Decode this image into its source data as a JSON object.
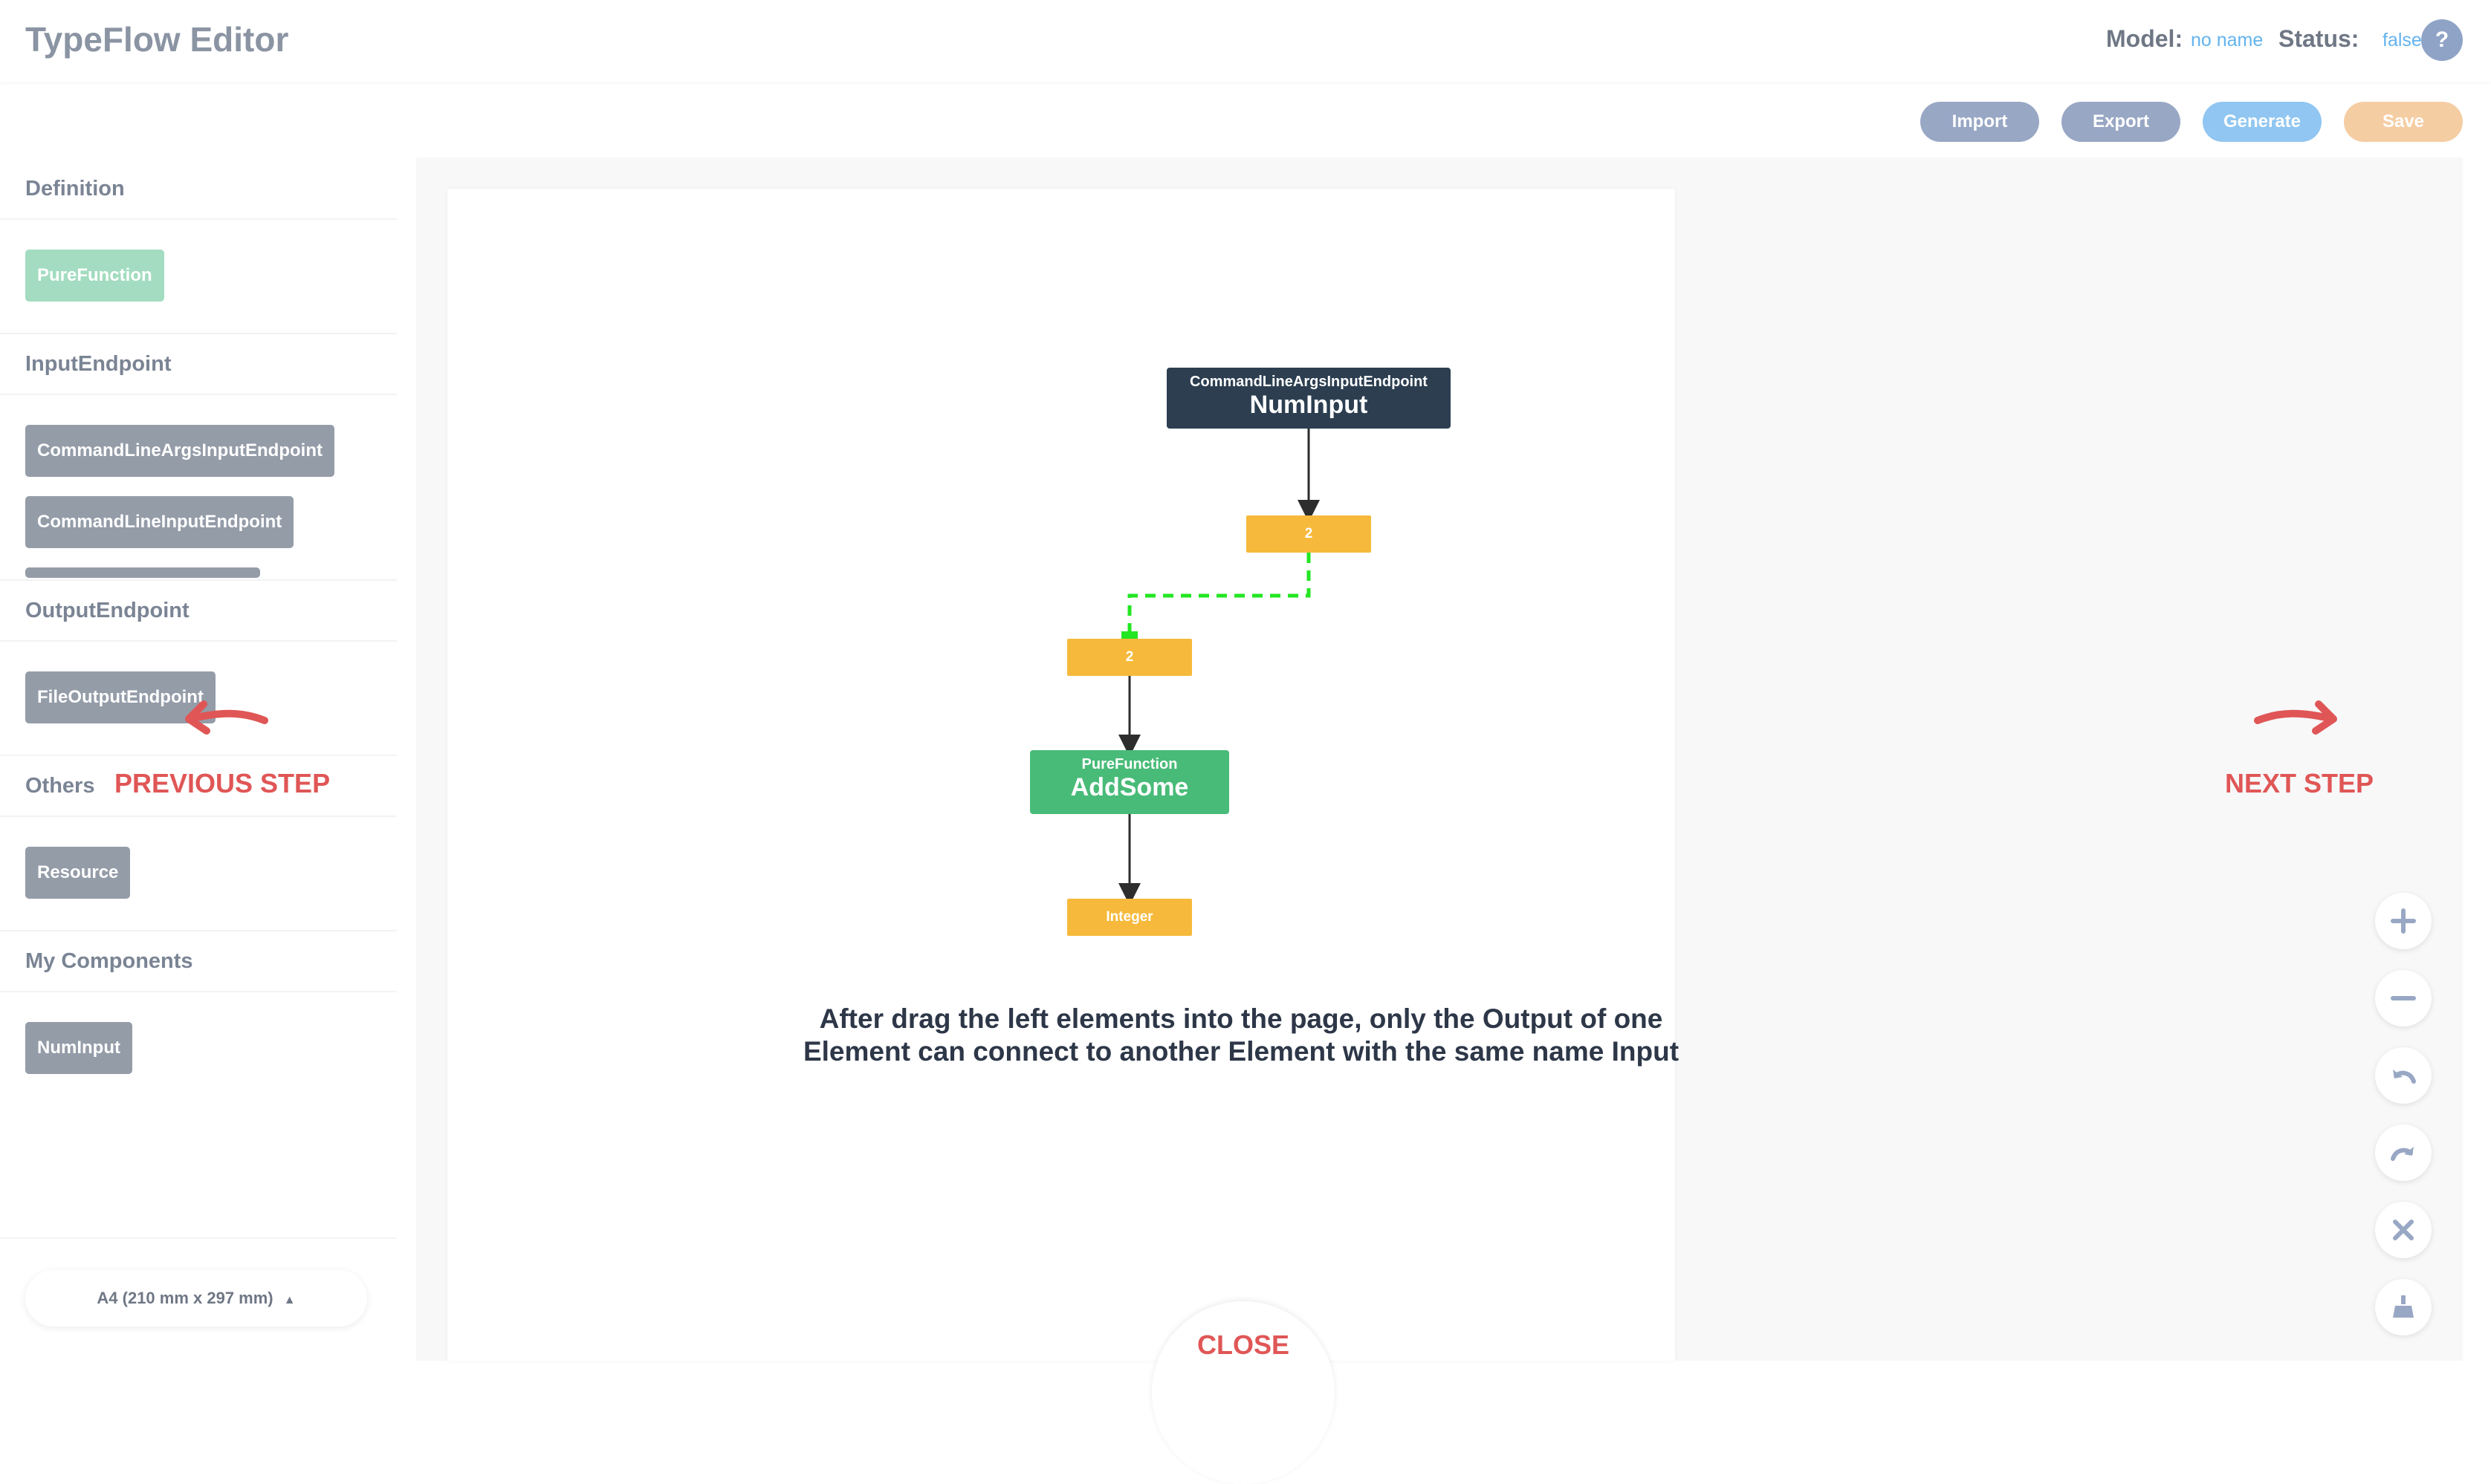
{
  "header": {
    "title": "TypeFlow Editor",
    "model_label": "Model:",
    "model_value": "no name",
    "status_label": "Status:",
    "status_value": "false",
    "help": "?"
  },
  "toolbar": {
    "import": "Import",
    "export": "Export",
    "generate": "Generate",
    "save": "Save"
  },
  "sidebar": {
    "sections": [
      {
        "title": "Definition",
        "items": [
          "PureFunction"
        ]
      },
      {
        "title": "InputEndpoint",
        "items": [
          "CommandLineArgsInputEndpoint",
          "CommandLineInputEndpoint"
        ]
      },
      {
        "title": "OutputEndpoint",
        "items": [
          "FileOutputEndpoint"
        ]
      },
      {
        "title": "Others",
        "items": [
          "Resource"
        ]
      },
      {
        "title": "My Components",
        "items": [
          "NumInput"
        ]
      }
    ],
    "paper_size": "A4 (210 mm x 297 mm)"
  },
  "canvas": {
    "nodes": {
      "numinput": {
        "type": "CommandLineArgsInputEndpoint",
        "name": "NumInput",
        "output_port": "2"
      },
      "addsome": {
        "type": "PureFunction",
        "name": "AddSome",
        "input_port": "2",
        "output_port": "Integer"
      }
    },
    "caption_line1": "After drag the left elements into the page, only the Output of one",
    "caption_line2": "Element can connect to another Element with the same name Input"
  },
  "guide": {
    "previous": "PREVIOUS STEP",
    "next": "NEXT STEP",
    "close": "CLOSE"
  },
  "zoom_controls": [
    "plus-icon",
    "minus-icon",
    "undo-icon",
    "redo-icon",
    "close-icon",
    "clean-icon"
  ],
  "colors": {
    "accent_blue": "#63b3ed",
    "guide_red": "#e05656",
    "port_yellow": "#f6b93b",
    "node_dark": "#2c3e50",
    "node_green": "#48bb78",
    "connection_green": "#22e622"
  }
}
